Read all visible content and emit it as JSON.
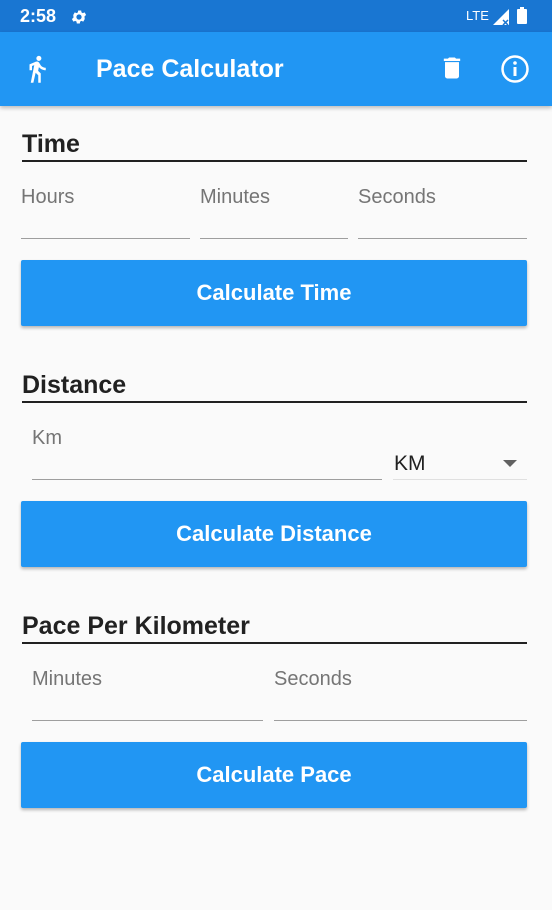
{
  "status_bar": {
    "time": "2:58",
    "network": "LTE"
  },
  "app_bar": {
    "title": "Pace Calculator"
  },
  "time_section": {
    "title": "Time",
    "hours_placeholder": "Hours",
    "minutes_placeholder": "Minutes",
    "seconds_placeholder": "Seconds",
    "button_label": "Calculate Time"
  },
  "distance_section": {
    "title": "Distance",
    "distance_placeholder": "Km",
    "unit_selected": "KM",
    "button_label": "Calculate Distance"
  },
  "pace_section": {
    "title": "Pace Per Kilometer",
    "minutes_placeholder": "Minutes",
    "seconds_placeholder": "Seconds",
    "button_label": "Calculate Pace"
  },
  "colors": {
    "status_bar": "#1976d2",
    "primary": "#2196f3",
    "background": "#fafafa"
  },
  "icons": {
    "status": [
      "gear-icon",
      "signal-icon",
      "battery-icon"
    ],
    "app_bar": [
      "runner-icon",
      "trash-icon",
      "info-icon"
    ],
    "dropdown": "chevron-down-icon"
  }
}
